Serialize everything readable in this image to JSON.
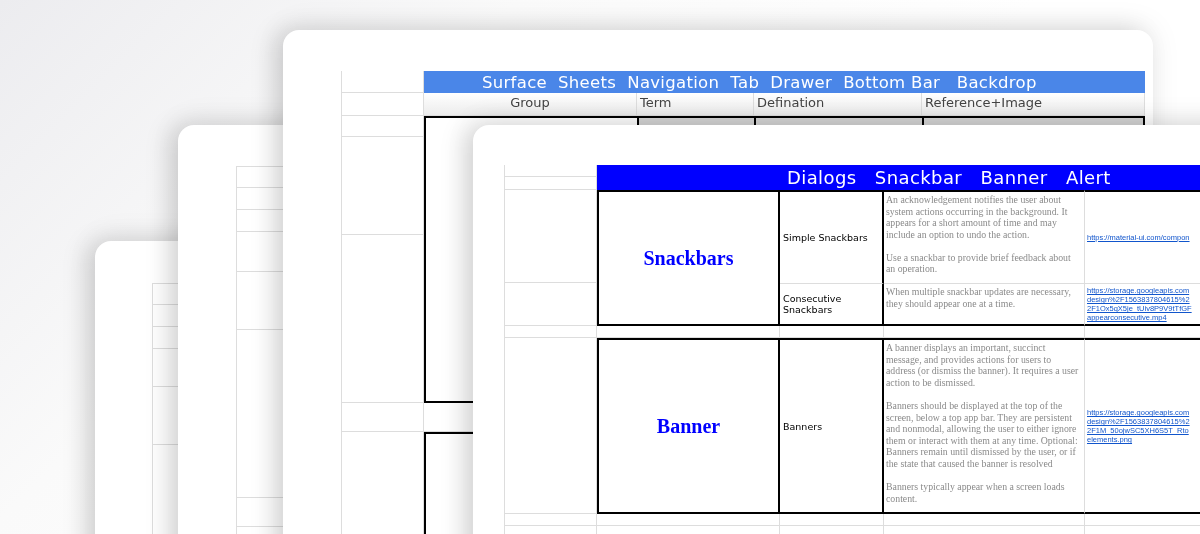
{
  "back_sheet": {
    "title": "Surface  Sheets  Navigation  Tab  Drawer  Bottom Bar   Backdrop",
    "columns": [
      "Group",
      "Term",
      "Defination",
      "Reference+Image"
    ]
  },
  "front_sheet": {
    "title": "Dialogs   Snackbar   Banner   Alert",
    "groups": [
      {
        "group": "Snackbars",
        "rows": [
          {
            "term": "Simple Snackbars",
            "definition": [
              "An acknowledgement notifies the user about system actions occurring in the background. It appears for a short amount of time and may include an option to undo the action.",
              "Use a snackbar to provide brief feedback about an operation."
            ],
            "reference": [
              "https://material-ui.com/compon"
            ]
          },
          {
            "term": "Consecutive Snackbars",
            "definition": [
              "When multiple snackbar updates are necessary, they should appear one at a time."
            ],
            "reference": [
              "https://storage.googleapis.com",
              "design%2F1563837804615%2",
              "2F1Ox5qX5je_tUiv8P9V9tTfGF",
              "appearconsecutive.mp4"
            ]
          }
        ]
      },
      {
        "group": "Banner",
        "rows": [
          {
            "term": "Banners",
            "definition": [
              "A banner displays an important, succinct message, and provides actions for users to address (or dismiss the banner). It requires a user action to be dismissed.",
              "Banners should be displayed at the top of the screen, below a top app bar. They are persistent and nonmodal, allowing the user to either ignore them or interact with them at any time. Optional: Banners remain until dismissed by the user, or if the state that caused the banner is resolved",
              "Banners typically appear when a screen loads content."
            ],
            "reference": [
              "https://storage.googleapis.com",
              "design%2F1563837804615%2",
              "2F1M_50ojwSC5XH6S5T_Rto",
              "elements.png"
            ]
          }
        ]
      }
    ]
  }
}
